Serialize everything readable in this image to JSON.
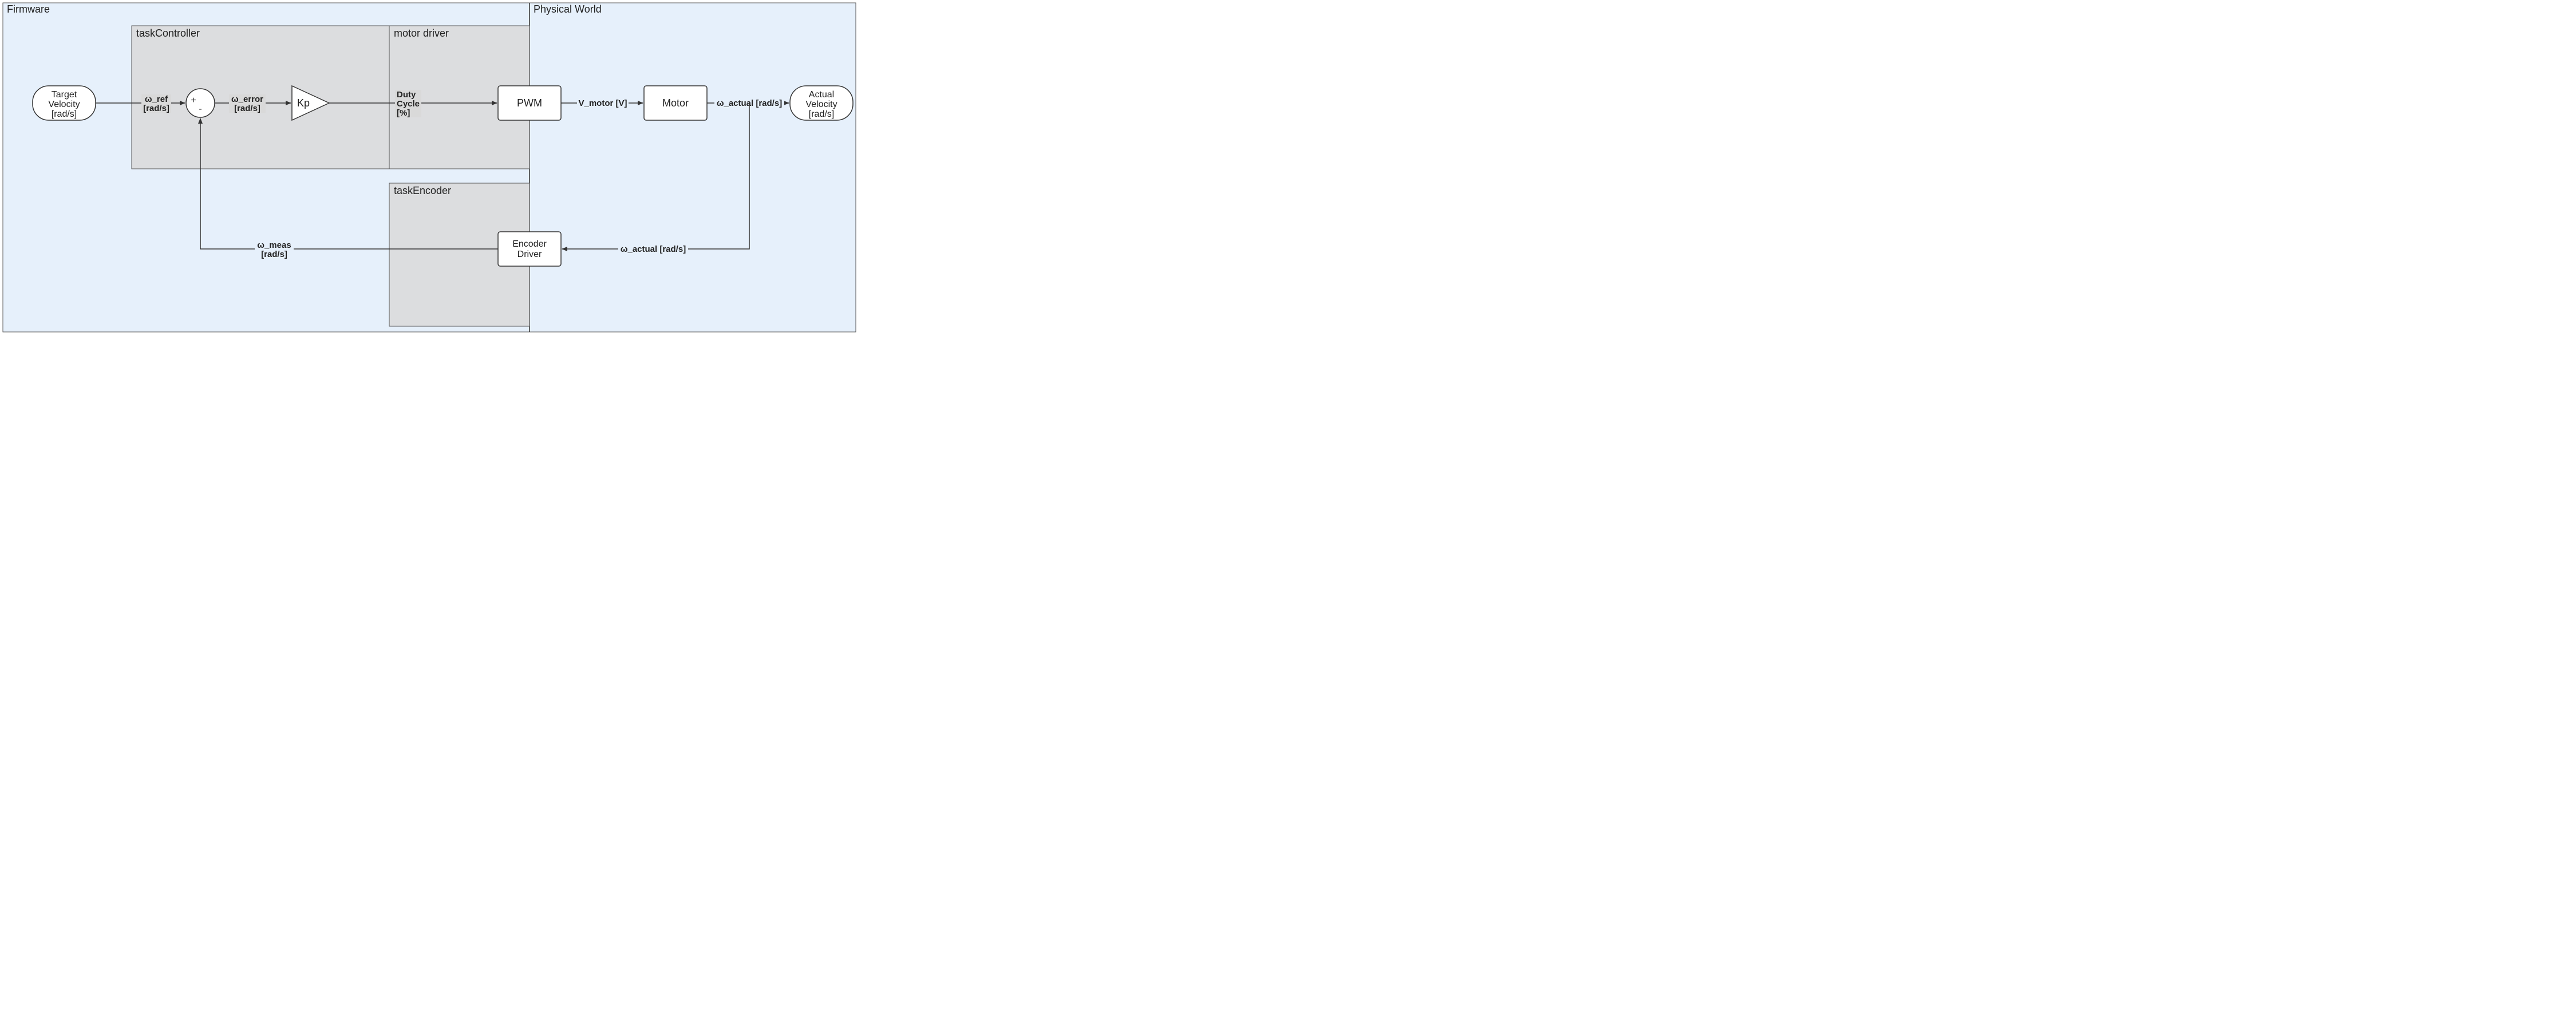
{
  "regions": {
    "firmware": {
      "title": "Firmware"
    },
    "physical": {
      "title": "Physical World"
    }
  },
  "subregions": {
    "taskController": {
      "title": "taskController"
    },
    "motorDriver": {
      "title": "motor driver"
    },
    "taskEncoder": {
      "title": "taskEncoder"
    }
  },
  "blocks": {
    "targetVelocity": {
      "line1": "Target",
      "line2": "Velocity",
      "line3": "[rad/s]"
    },
    "kp": {
      "label": "Kp"
    },
    "pwm": {
      "label": "PWM"
    },
    "motor": {
      "label": "Motor"
    },
    "actualVelocity": {
      "line1": "Actual",
      "line2": "Velocity",
      "line3": "[rad/s]"
    },
    "encoderDriver": {
      "line1": "Encoder",
      "line2": "Driver"
    }
  },
  "summing": {
    "plus": "+",
    "minus": "-"
  },
  "signals": {
    "w_ref": {
      "line1": "ω_ref",
      "line2": "[rad/s]"
    },
    "w_error": {
      "line1": "ω_error",
      "line2": "[rad/s]"
    },
    "dutyCycle": {
      "line1": "Duty",
      "line2": "Cycle",
      "line3": "[%]"
    },
    "v_motor": {
      "label": "V_motor [V]"
    },
    "w_actual_top": {
      "label": "ω_actual [rad/s]"
    },
    "w_actual_fb": {
      "label": "ω_actual [rad/s]"
    },
    "w_meas": {
      "line1": "ω_meas",
      "line2": "[rad/s]"
    }
  }
}
